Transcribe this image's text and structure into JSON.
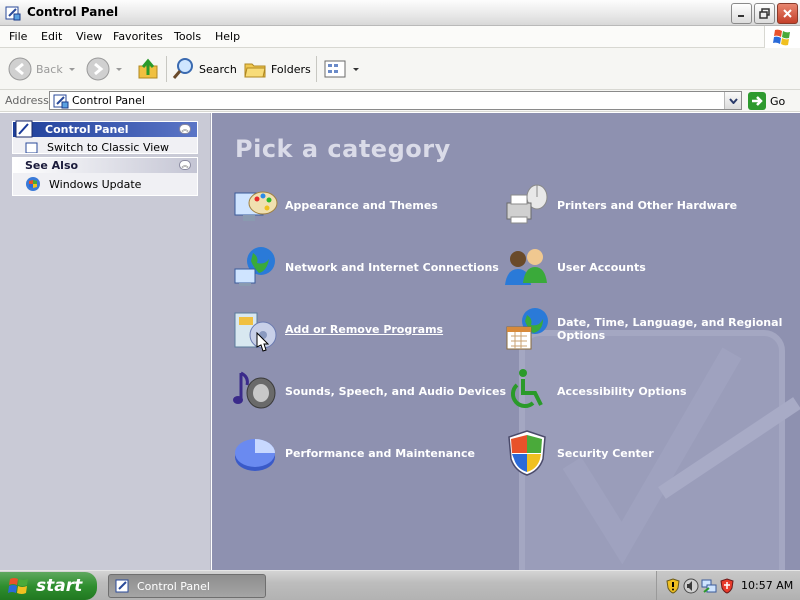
{
  "window": {
    "title": "Control Panel"
  },
  "menu": [
    "File",
    "Edit",
    "View",
    "Favorites",
    "Tools",
    "Help"
  ],
  "toolbar": {
    "back": "Back",
    "search": "Search",
    "folders": "Folders"
  },
  "address": {
    "label": "Address",
    "value": "Control Panel",
    "go": "Go"
  },
  "sidebar": {
    "control_panel": {
      "title": "Control Panel",
      "item": "Switch to Classic View"
    },
    "see_also": {
      "title": "See Also",
      "item": "Windows Update"
    }
  },
  "main": {
    "heading": "Pick a category",
    "categories": [
      {
        "label": "Appearance and Themes",
        "icon": "appearance-icon"
      },
      {
        "label": "Printers and Other Hardware",
        "icon": "printer-icon"
      },
      {
        "label": "Network and Internet Connections",
        "icon": "network-icon"
      },
      {
        "label": "User Accounts",
        "icon": "users-icon"
      },
      {
        "label": "Add or Remove Programs",
        "icon": "add-remove-programs-icon"
      },
      {
        "label": "Date, Time, Language, and Regional Options",
        "icon": "date-time-icon"
      },
      {
        "label": "Sounds, Speech, and Audio Devices",
        "icon": "sound-icon"
      },
      {
        "label": "Accessibility Options",
        "icon": "accessibility-icon"
      },
      {
        "label": "Performance and Maintenance",
        "icon": "performance-icon"
      },
      {
        "label": "Security Center",
        "icon": "security-shield-icon"
      }
    ]
  },
  "taskbar": {
    "start": "start",
    "task": "Control Panel",
    "clock": "10:57 AM"
  },
  "colors": {
    "content_bg": "#8e91b0",
    "sidebar_bg": "#c9cad6",
    "start_green": "#2f8f2f"
  }
}
